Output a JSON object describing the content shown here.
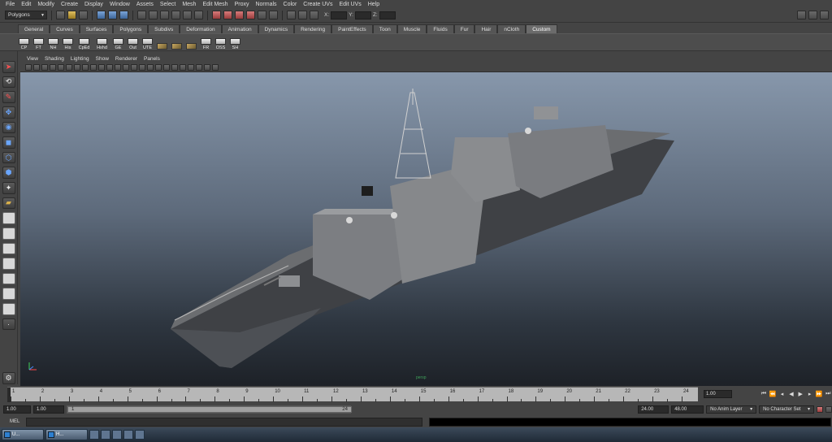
{
  "menubar": [
    "File",
    "Edit",
    "Modify",
    "Create",
    "Display",
    "Window",
    "Assets",
    "Select",
    "Mesh",
    "Edit Mesh",
    "Proxy",
    "Normals",
    "Color",
    "Create UVs",
    "Edit UVs",
    "Help"
  ],
  "status_line": {
    "mode": "Polygons",
    "xyz_labels": [
      "X:",
      "Y:",
      "Z:"
    ]
  },
  "shelf_tabs": [
    "General",
    "Curves",
    "Surfaces",
    "Polygons",
    "Subdivs",
    "Deformation",
    "Animation",
    "Dynamics",
    "Rendering",
    "PaintEffects",
    "Toon",
    "Muscle",
    "Fluids",
    "Fur",
    "Hair",
    "nCloth",
    "Custom"
  ],
  "active_shelf_tab": "Custom",
  "shelf_buttons": [
    "CP",
    "FT",
    "NH",
    "His",
    "CpEd",
    "Hshd",
    "GE",
    "Out",
    "UTE",
    "",
    "",
    "",
    "FR",
    "OSS",
    "SH"
  ],
  "panel_menu": [
    "View",
    "Shading",
    "Lighting",
    "Show",
    "Renderer",
    "Panels"
  ],
  "viewport": {
    "label": "persp",
    "axis_labels": [
      "y",
      "x",
      "z"
    ]
  },
  "time_slider": {
    "ticks": [
      "1",
      "2",
      "3",
      "4",
      "5",
      "6",
      "7",
      "8",
      "9",
      "10",
      "11",
      "12",
      "13",
      "14",
      "15",
      "16",
      "17",
      "18",
      "19",
      "20",
      "21",
      "22",
      "23",
      "24"
    ],
    "current_time": "1.00"
  },
  "range": {
    "start": "1.00",
    "inner_start": "1.00",
    "handle_start": "1",
    "handle_end": "24",
    "end": "24.00",
    "anim_end": "48.00",
    "anim_layer": "No Anim Layer",
    "character_set": "No Character Set"
  },
  "command_line": {
    "label": "MEL"
  },
  "taskbar": [
    "U...",
    "H..."
  ]
}
